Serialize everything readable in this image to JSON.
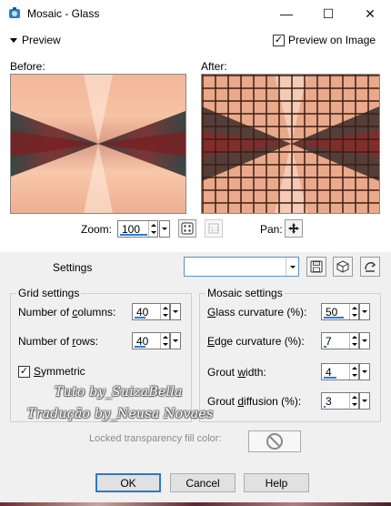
{
  "window": {
    "title": "Mosaic - Glass",
    "minimize_glyph": "—",
    "maximize_glyph": "☐",
    "close_glyph": "✕"
  },
  "preview": {
    "label": "Preview",
    "preview_on_image_label": "Preview on Image",
    "preview_on_image_checked": true
  },
  "images": {
    "before_label": "Before:",
    "after_label": "After:"
  },
  "zoom": {
    "label": "Zoom:",
    "value": "100",
    "pan_label": "Pan:"
  },
  "settings": {
    "label": "Settings",
    "preset_value": ""
  },
  "grid_settings": {
    "title": "Grid settings",
    "columns_label_pre": "Number of ",
    "columns_label_u": "c",
    "columns_label_post": "olumns:",
    "columns_value": "40",
    "rows_label_pre": "Number of ",
    "rows_label_u": "r",
    "rows_label_post": "ows:",
    "rows_value": "40",
    "symmetric_label_u": "S",
    "symmetric_label_post": "ymmetric",
    "symmetric_checked": true
  },
  "mosaic_settings": {
    "title": "Mosaic settings",
    "glass_label_u": "G",
    "glass_label_post": "lass curvature (%):",
    "glass_value": "50",
    "edge_label_u": "E",
    "edge_label_post": "dge curvature (%):",
    "edge_value": "7",
    "grout_width_label_pre": "Grout ",
    "grout_width_label_u": "w",
    "grout_width_label_post": "idth:",
    "grout_width_value": "4",
    "grout_diffusion_label_pre": "Grout ",
    "grout_diffusion_label_u": "d",
    "grout_diffusion_label_post": "iffusion (%):",
    "grout_diffusion_value": "3"
  },
  "watermark": {
    "line1": "Tuto by_SuizaBella",
    "line2": "Tradução by_Neusa Novaes"
  },
  "locked": {
    "label": "Locked transparency fill color:"
  },
  "buttons": {
    "ok": "OK",
    "cancel": "Cancel",
    "help": "Help"
  },
  "colors": {
    "accent": "#2f77c8",
    "panel_bg": "#f0f0f0",
    "slider_bar": "#2a7bd4"
  },
  "icons": [
    "app-icon",
    "minimize-icon",
    "maximize-icon",
    "close-icon",
    "pan-icon",
    "random-icon",
    "reset-icon",
    "save-preset-icon",
    "load-preset-icon",
    "delete-preset-icon",
    "no-color-icon"
  ]
}
